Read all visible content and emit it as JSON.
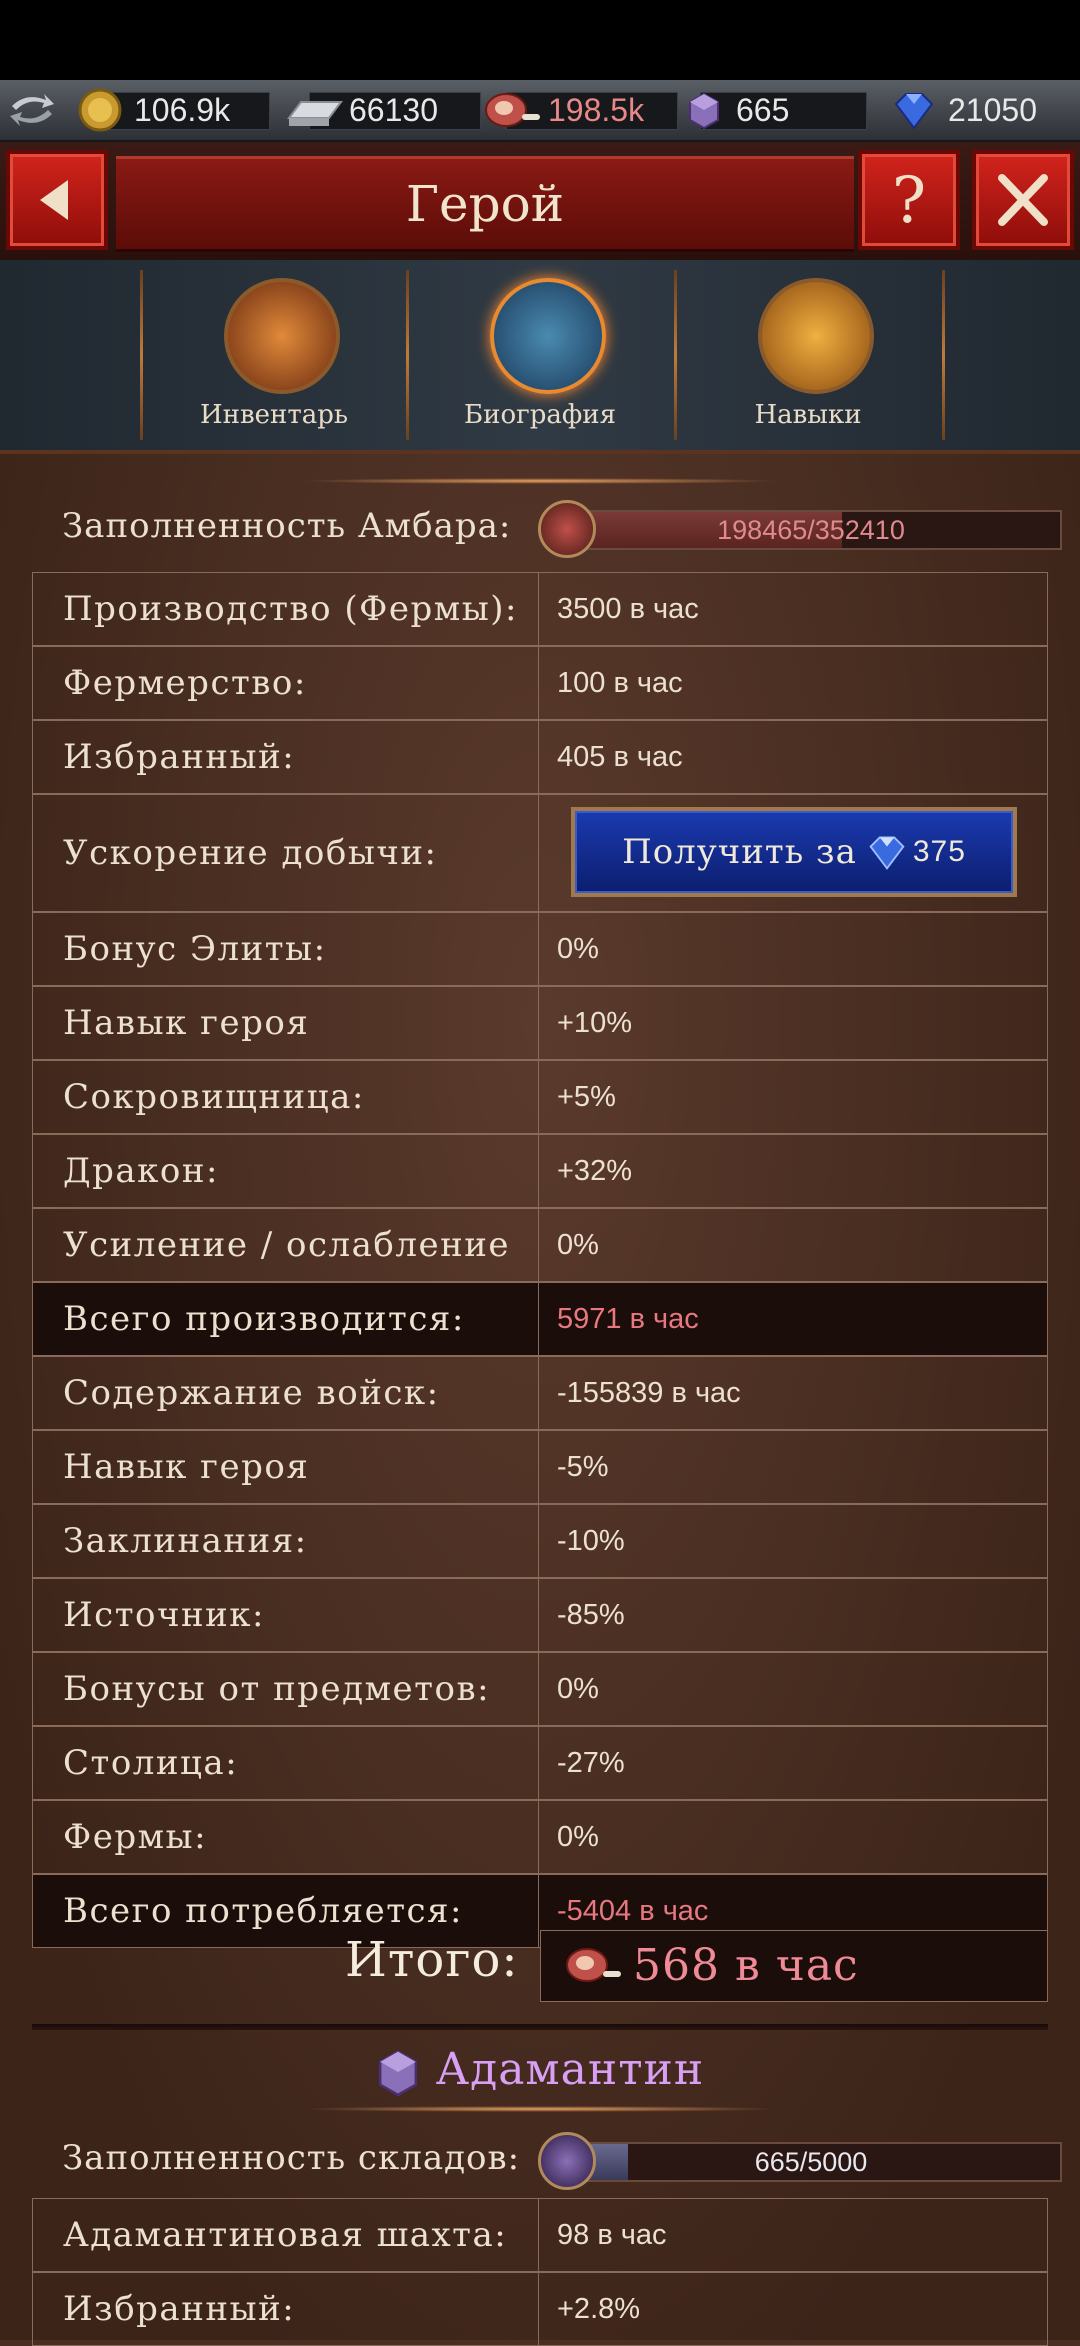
{
  "resources": {
    "gold": "106.9k",
    "iron": "66130",
    "food": "198.5k",
    "adamantine": "665",
    "gems": "21050"
  },
  "header": {
    "title": "Герой"
  },
  "tabs": [
    {
      "label": "Инвентарь"
    },
    {
      "label": "Биография"
    },
    {
      "label": "Навыки"
    }
  ],
  "food": {
    "storage_label": "Заполненность Амбара:",
    "storage_value": "198465/352410",
    "storage_fill": 0.563,
    "rows": [
      {
        "label": "Производство (Фермы):",
        "value": "3500 в час"
      },
      {
        "label": "Фермерство:",
        "value": "100 в час"
      },
      {
        "label": "Избранный:",
        "value": "405 в час"
      },
      {
        "label": "Ускорение добычи:",
        "button": "Получить за",
        "button_cost": "375"
      },
      {
        "label": "Бонус Элиты:",
        "value": "0%"
      },
      {
        "label": "Навык героя",
        "value": "+10%"
      },
      {
        "label": "Сокровищница:",
        "value": "+5%"
      },
      {
        "label": "Дракон:",
        "value": "+32%"
      },
      {
        "label": "Усиление / ослабление",
        "value": "0%"
      },
      {
        "label": "Всего производится:",
        "value": "5971 в час"
      },
      {
        "label": "Содержание войск:",
        "value": "-155839 в час"
      },
      {
        "label": "Навык героя",
        "value": "-5%"
      },
      {
        "label": "Заклинания:",
        "value": "-10%"
      },
      {
        "label": "Источник:",
        "value": "-85%"
      },
      {
        "label": "Бонусы от предметов:",
        "value": "0%"
      },
      {
        "label": "Столица:",
        "value": "-27%"
      },
      {
        "label": "Фермы:",
        "value": "0%"
      },
      {
        "label": "Всего потребляется:",
        "value": "-5404 в час"
      }
    ],
    "total_label": "Итого:",
    "total_value": "568 в час"
  },
  "adamantine": {
    "title": "Адамантин",
    "storage_label": "Заполненность складов:",
    "storage_value": "665/5000",
    "storage_fill": 0.133,
    "rows": [
      {
        "label": "Адамантиновая шахта:",
        "value": "98 в час"
      },
      {
        "label": "Избранный:",
        "value": "+2.8%"
      }
    ]
  },
  "colors": {
    "accent_red": "#c41a14",
    "negative_text": "#e87880",
    "adamantine_purple": "#d8a0f4",
    "button_blue": "#1a3ab0"
  }
}
